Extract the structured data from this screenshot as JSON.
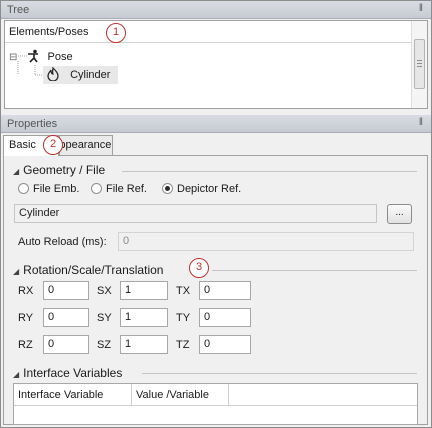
{
  "tree_panel": {
    "title": "Tree",
    "pin": "‖"
  },
  "tree": {
    "column_header": "Elements/Poses",
    "nodes": [
      {
        "label": "Pose",
        "icon": "pose-figure-icon",
        "expander": "⊟"
      },
      {
        "label": "Cylinder",
        "icon": "flame-icon"
      }
    ]
  },
  "properties_panel": {
    "title": "Properties",
    "pin": "‖"
  },
  "tabs": {
    "basic": "Basic",
    "appearance": "Appearance"
  },
  "callouts": [
    "1",
    "2",
    "3"
  ],
  "geometry": {
    "title": "Geometry / File",
    "options": [
      "File Emb.",
      "File Ref.",
      "Depictor Ref."
    ],
    "selected": "Depictor Ref.",
    "file_value": "Cylinder",
    "browse_label": "...",
    "auto_reload_label": "Auto Reload (ms):",
    "auto_reload_value": "0"
  },
  "transform": {
    "title": "Rotation/Scale/Translation",
    "rows": [
      [
        {
          "label": "RX",
          "value": "0"
        },
        {
          "label": "SX",
          "value": "1"
        },
        {
          "label": "TX",
          "value": "0"
        }
      ],
      [
        {
          "label": "RY",
          "value": "0"
        },
        {
          "label": "SY",
          "value": "1"
        },
        {
          "label": "TY",
          "value": "0"
        }
      ],
      [
        {
          "label": "RZ",
          "value": "0"
        },
        {
          "label": "SZ",
          "value": "1"
        },
        {
          "label": "TZ",
          "value": "0"
        }
      ]
    ]
  },
  "interface": {
    "title": "Interface Variables",
    "columns": [
      "Interface Variable",
      "Value /Variable"
    ]
  },
  "colors": {
    "callout": "#c0312f",
    "header_bg": "#c6cad2"
  }
}
